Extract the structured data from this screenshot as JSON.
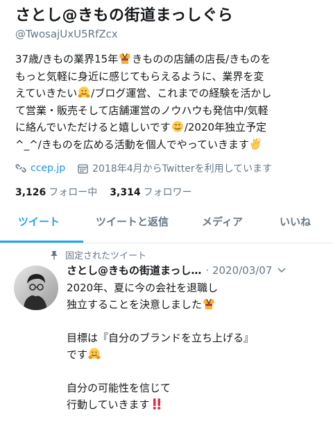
{
  "profile": {
    "name": "さとし@きもの街道まっしぐら",
    "handle": "@TwosajUxU5RfZcx",
    "bio_lines": [
      [
        "37歳/きもの業界15年",
        "kimono-emoji",
        "きものの店舗の店長/きものを"
      ],
      [
        "もっと気軽に身近に感じてもらえるように、業界を変",
        "",
        ""
      ],
      [
        "えていきたい",
        "hugging-face-emoji",
        "/ブログ運営、これまでの経験を活かし"
      ],
      [
        "て営業・販売そして店舗運営のノウハウも発信中/気軽",
        "",
        ""
      ],
      [
        "に絡んでいただけると嬉しいです",
        "smiling-face-emoji",
        "/2020年独立予定"
      ],
      [
        "^_^/きものを広める活動を個人でやっていきます",
        "clapping-hands-emoji",
        ""
      ]
    ],
    "link": "ccep.jp",
    "joined": "2018年4月からTwitterを利用しています",
    "following_count": "3,126",
    "following_label": "フォロー中",
    "followers_count": "3,314",
    "followers_label": "フォロワー"
  },
  "tabs": [
    {
      "label": "ツイート",
      "active": true
    },
    {
      "label": "ツイートと返信",
      "active": false
    },
    {
      "label": "メディア",
      "active": false
    },
    {
      "label": "いいね",
      "active": false
    }
  ],
  "pinned_tweet": {
    "pinned_label": "固定されたツイート",
    "author": "さとし@きもの街道まっし…",
    "date": "· 2020/03/07",
    "lines": [
      [
        "2020年、夏に今の会社を退職し",
        ""
      ],
      [
        "独立することを決意しました",
        "kimono-emoji"
      ],
      [
        "",
        ""
      ],
      [
        "目標は『自分のブランドを立ち上げる』",
        ""
      ],
      [
        "です",
        "hugging-face-emoji"
      ],
      [
        "",
        ""
      ],
      [
        "自分の可能性を信じて",
        ""
      ],
      [
        "行動していきます",
        "double-exclamation-emoji"
      ]
    ]
  },
  "colors": {
    "accent": "#1da1f2",
    "link": "#1b95e0",
    "secondary_text": "#657786",
    "divider": "#e1e8ed"
  }
}
